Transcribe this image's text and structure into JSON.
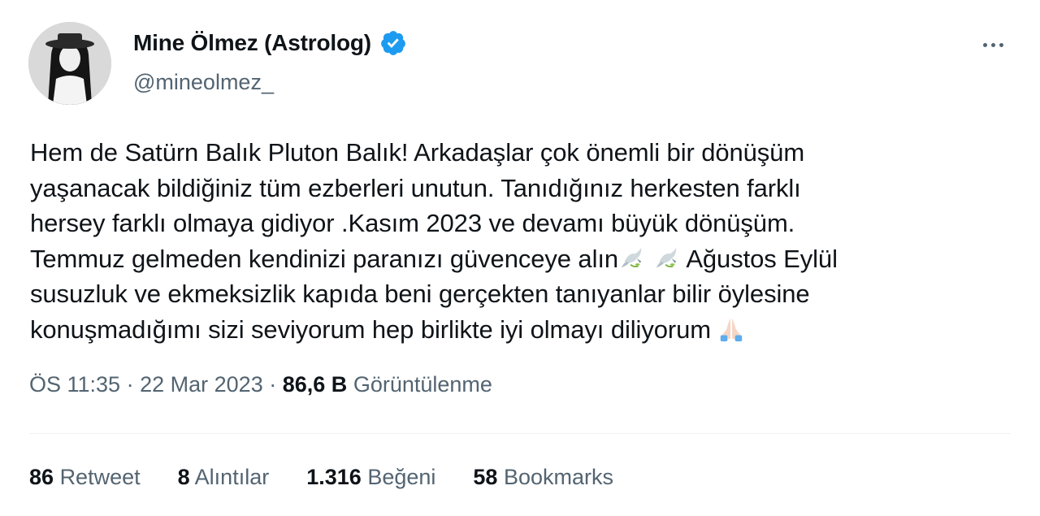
{
  "author": {
    "display_name": "Mine Ölmez (Astrolog)",
    "handle": "@mineolmez_",
    "verified": true,
    "verified_color": "#1d9bf0",
    "avatar_icon": "profile-photo"
  },
  "tweet": {
    "lines": [
      "Hem de Satürn Balık Pluton Balık! Arkadaşlar çok önemli bir dönüşüm",
      "yaşanacak bildiğiniz tüm ezberleri unutun. Tanıdığınız herkesten farklı",
      "hersey farklı olmaya gidiyor .Kasım 2023 ve devamı büyük dönüşüm.",
      "Temmuz gelmeden kendinizi paranızı güvenceye alın",
      "Ağustos Eylül",
      "susuzluk ve ekmeksizlik kapıda beni gerçekten tanıyanlar bilir öylesine",
      "konuşmadığımı sizi seviyorum hep birlikte iyi olmayı diliyorum"
    ],
    "emojis": [
      "dove-icon",
      "dove-icon",
      "praying-hands-icon"
    ]
  },
  "meta": {
    "time": "ÖS 11:35",
    "separator": "·",
    "date": "22 Mar 2023",
    "views_count": "86,6 B",
    "views_label": "Görüntülenme"
  },
  "stats": {
    "retweets_count": "86",
    "retweets_label": "Retweet",
    "quotes_count": "8",
    "quotes_label": "Alıntılar",
    "likes_count": "1.316",
    "likes_label": "Beğeni",
    "bookmarks_count": "58",
    "bookmarks_label": "Bookmarks"
  },
  "colors": {
    "text_primary": "#0f1419",
    "text_secondary": "#536471",
    "divider": "#eff3f4"
  }
}
